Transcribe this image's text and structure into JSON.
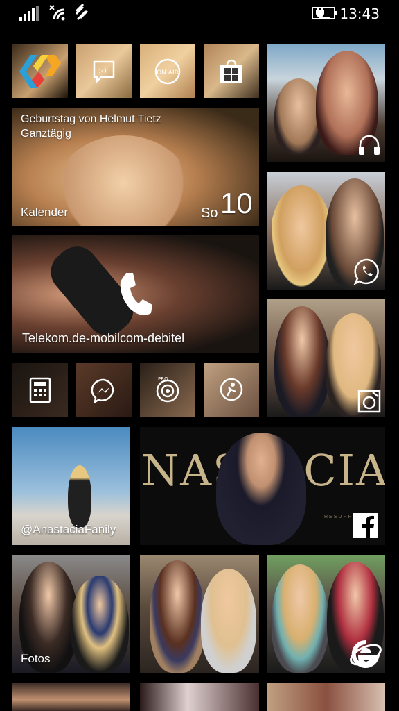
{
  "status_bar": {
    "time": "13:43",
    "icons": [
      "signal-bars-icon",
      "wifi-icon",
      "data-transfer-icon",
      "battery-charging-icon"
    ]
  },
  "tiles": {
    "app_tile_1": {
      "icon": "ap-logo-icon"
    },
    "messaging": {
      "icon": "messaging-icon"
    },
    "on_air": {
      "icon": "on-air-icon",
      "text": "ON AIR"
    },
    "store": {
      "icon": "store-icon"
    },
    "calendar": {
      "event_title": "Geburtstag von Helmut Tietz",
      "event_time": "Ganztägig",
      "label": "Kalender",
      "weekday": "So",
      "day": "10"
    },
    "music": {
      "icon": "headphones-icon"
    },
    "whatsapp": {
      "icon": "whatsapp-icon"
    },
    "phone": {
      "label": "Telekom.de-mobilcom-debitel",
      "icon": "phone-icon"
    },
    "calculator": {
      "icon": "calculator-icon"
    },
    "messenger": {
      "icon": "messenger-icon"
    },
    "pro_app": {
      "icon": "pro-camera-icon",
      "text": "PRO"
    },
    "sports": {
      "icon": "sports-icon"
    },
    "lens": {
      "icon": "camera-lens-icon"
    },
    "twitter": {
      "label": "@AnastaciaFanily"
    },
    "facebook": {
      "banner_text": "NASTACIA",
      "subtitle": "RESURRECTION",
      "icon": "facebook-icon"
    },
    "photos": {
      "label": "Fotos"
    },
    "ie": {
      "icon": "internet-explorer-icon"
    }
  }
}
